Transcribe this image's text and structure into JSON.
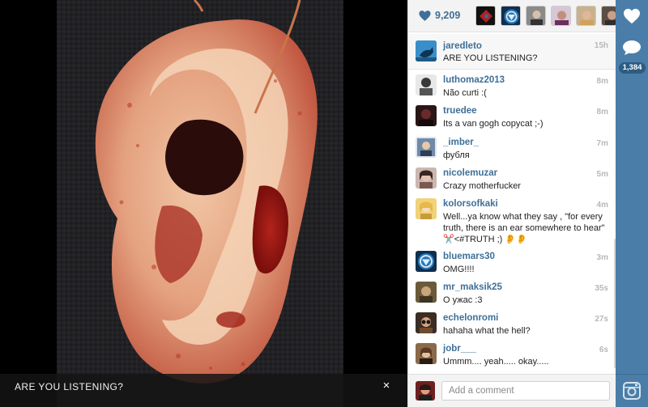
{
  "photo": {
    "caption": "ARE YOU LISTENING?",
    "close_label": "×"
  },
  "likes": {
    "count": "9,209"
  },
  "post": {
    "username": "jaredleto",
    "caption": "ARE YOU LISTENING?",
    "time": "15h"
  },
  "comments": [
    {
      "username": "luthomaz2013",
      "text": "Não curti :(",
      "time": "8m"
    },
    {
      "username": "truedee",
      "text": "Its a van gogh copycat ;-)",
      "time": "8m"
    },
    {
      "username": "_imber_",
      "text": "фубля",
      "time": "7m"
    },
    {
      "username": "nicolemuzar",
      "text": "Crazy motherfucker",
      "time": "5m"
    },
    {
      "username": "kolorsofkaki",
      "text": "Well...ya know what they say , \"for every truth, there is an ear somewhere to hear\" ✂️<#TRUTH ;) 👂👂",
      "time": "4m"
    },
    {
      "username": "bluemars30",
      "text": "OMG!!!!",
      "time": "3m"
    },
    {
      "username": "mr_maksik25",
      "text": "О ужас :3",
      "time": "35s"
    },
    {
      "username": "echelonromi",
      "text": "hahaha what the hell?",
      "time": "27s"
    },
    {
      "username": "jobr___",
      "text": "Ummm.... yeah..... okay.....",
      "time": "6s"
    }
  ],
  "comment_input": {
    "placeholder": "Add a comment"
  },
  "rail": {
    "comment_count": "1,384"
  },
  "colors": {
    "accent": "#3f6f98",
    "rail": "#4a7ea8"
  }
}
